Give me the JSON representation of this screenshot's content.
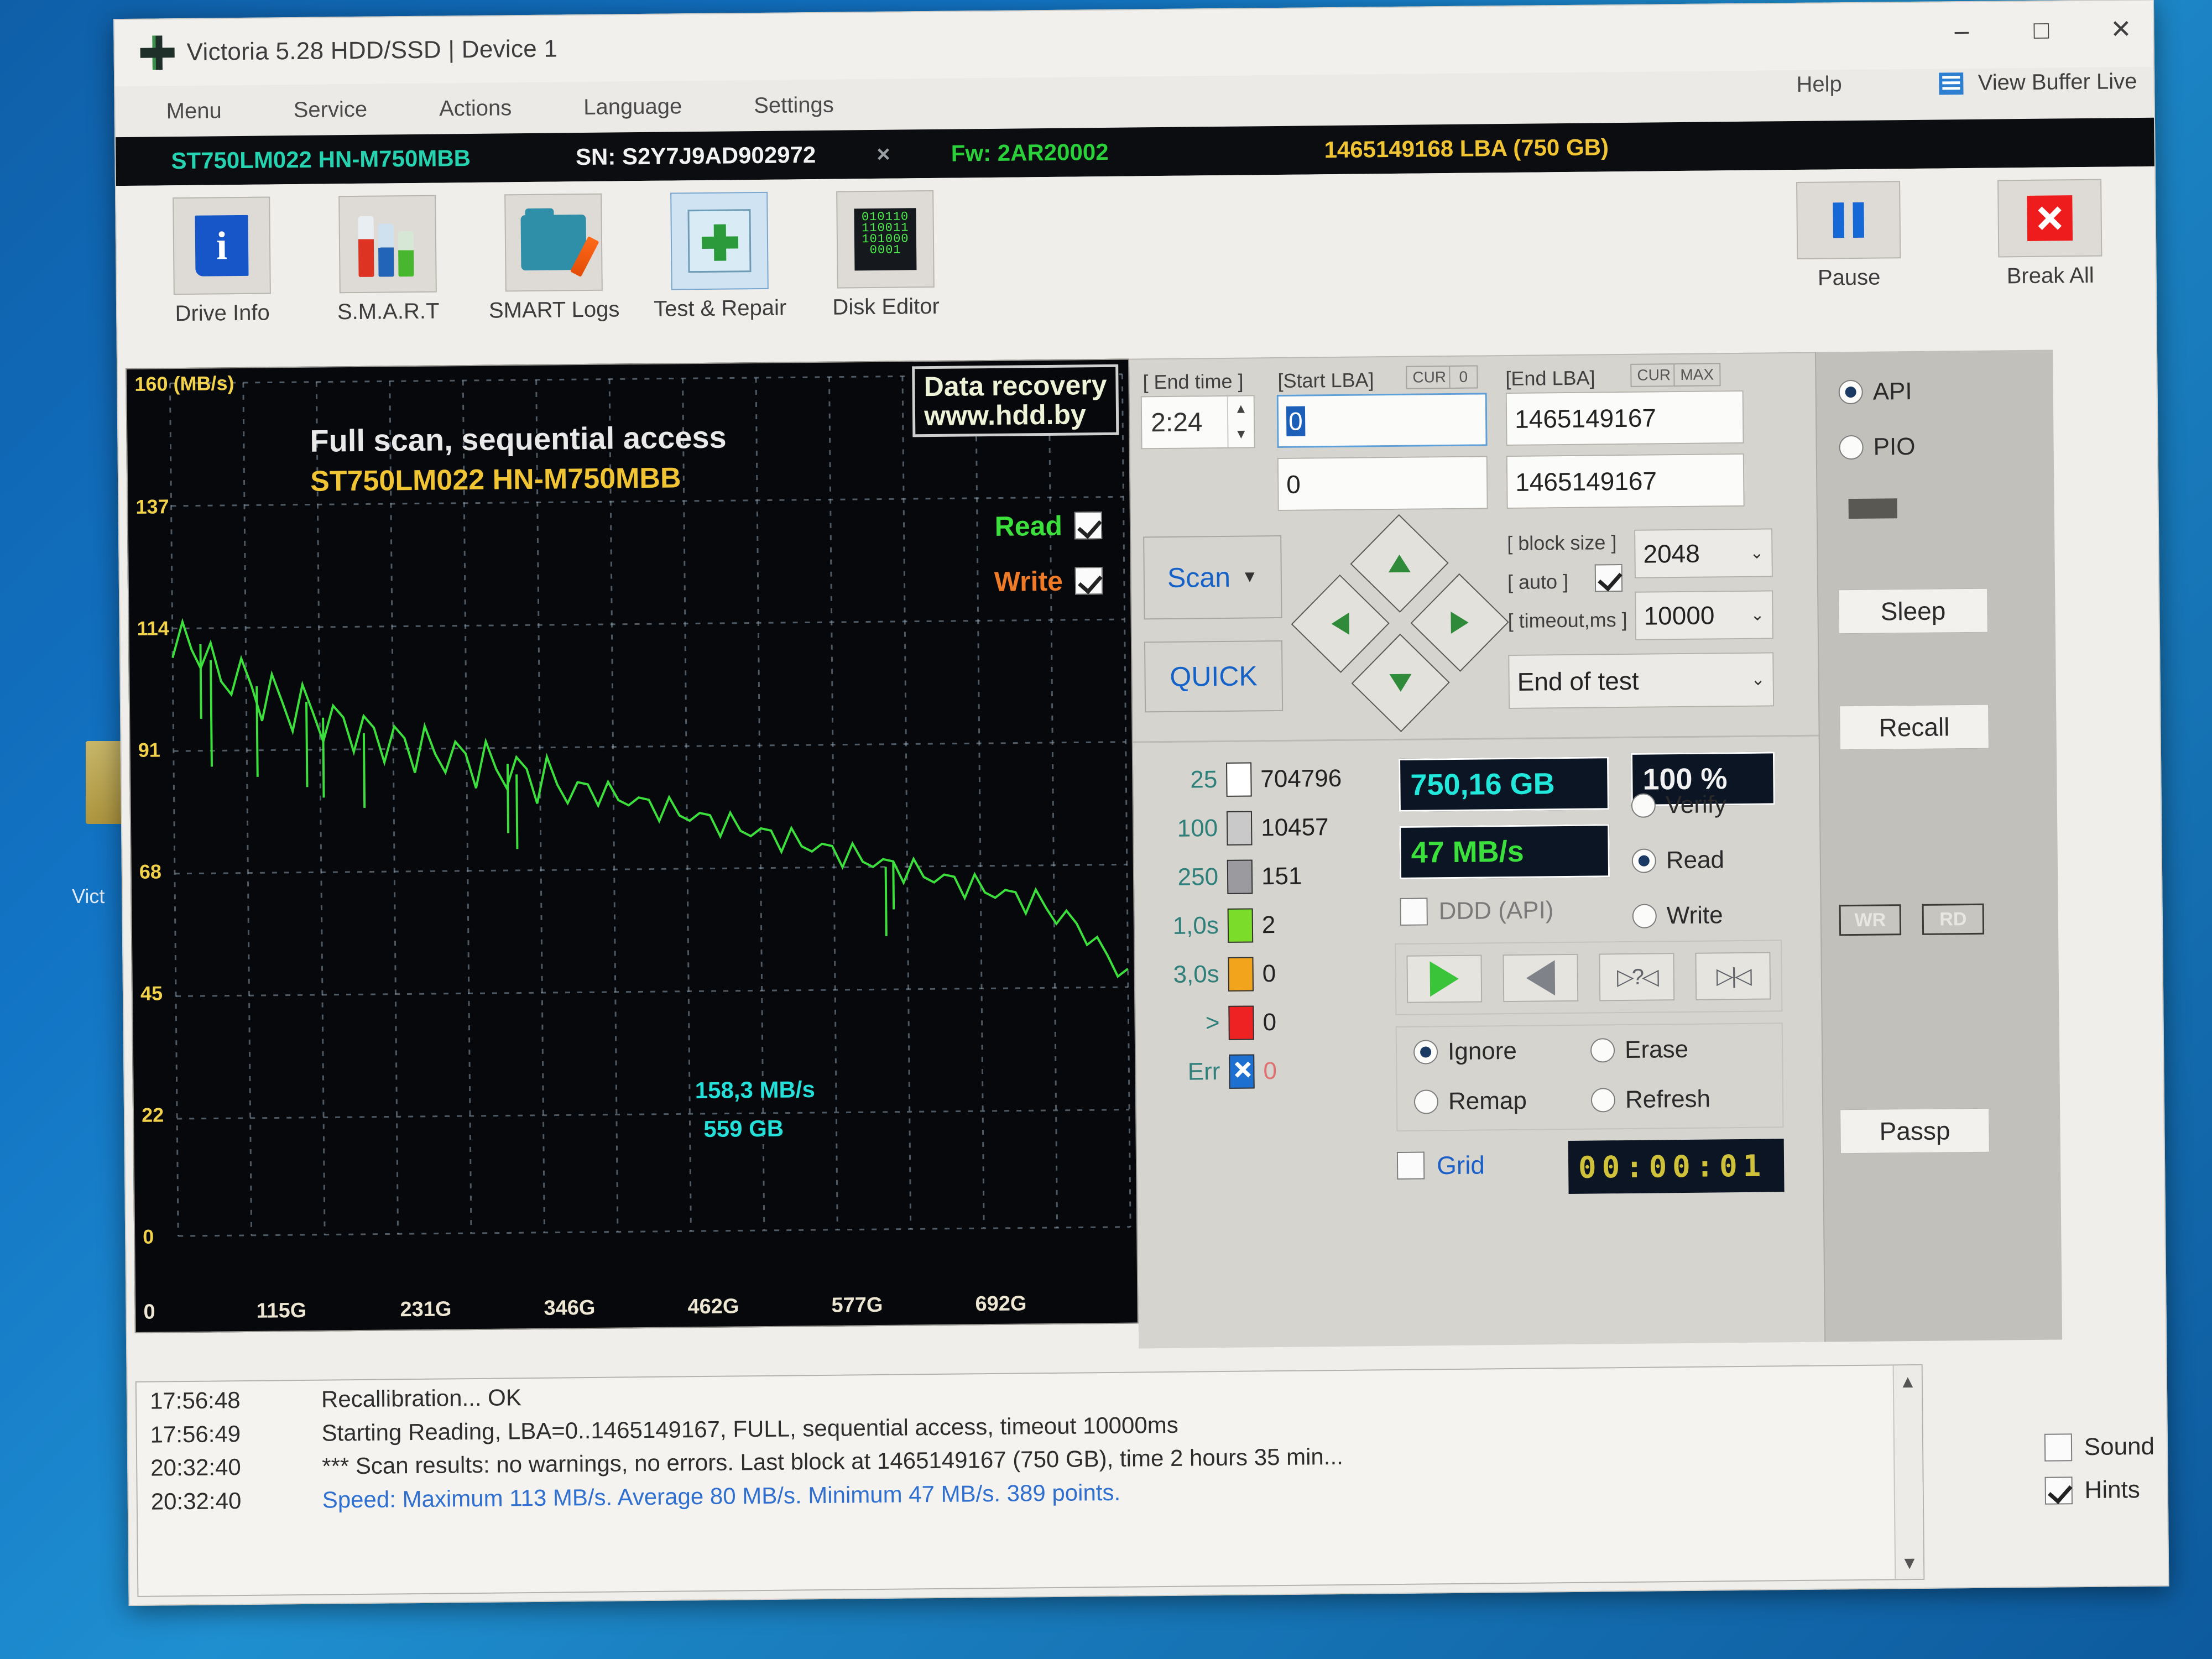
{
  "window": {
    "title": "Victoria 5.28 HDD/SSD | Device 1",
    "minimize": "–",
    "maximize": "□",
    "close": "✕"
  },
  "menu": {
    "items": [
      "Menu",
      "Service",
      "Actions",
      "Language",
      "Settings"
    ],
    "help": "Help",
    "view_buffer": "View Buffer Live"
  },
  "drive_bar": {
    "model": "ST750LM022 HN-M750MBB",
    "serial": "SN: S2Y7J9AD902972",
    "x": "×",
    "firmware": "Fw: 2AR20002",
    "capacity": "1465149168 LBA  (750 GB)"
  },
  "toolbar": {
    "items": [
      {
        "label": "Drive Info",
        "icon": "info-icon"
      },
      {
        "label": "S.M.A.R.T",
        "icon": "test-tubes-icon"
      },
      {
        "label": "SMART Logs",
        "icon": "folder-pencil-icon"
      },
      {
        "label": "Test & Repair",
        "icon": "clipboard-plus-icon"
      },
      {
        "label": "Disk Editor",
        "icon": "binary-icon"
      }
    ],
    "pause": "Pause",
    "break_all": "Break All"
  },
  "graph": {
    "title": "Full scan, sequential access",
    "subtitle": "ST750LM022 HN-M750MBB",
    "badge_line1": "Data recovery",
    "badge_line2": "www.hdd.by",
    "read_label": "Read",
    "read_checked": true,
    "write_label": "Write",
    "write_checked": true,
    "annot_speed": "158,3 MB/s",
    "annot_size": "559 GB"
  },
  "chart_data": {
    "type": "line",
    "title": "Full scan, sequential access",
    "subtitle": "ST750LM022 HN-M750MBB",
    "xlabel": "",
    "ylabel": "MB/s",
    "yunit": "160 (MB/s)",
    "ylim": [
      0,
      160
    ],
    "yticks": [
      0,
      22,
      45,
      68,
      91,
      114,
      137,
      160
    ],
    "ytick_labels": [
      "0",
      "22",
      "45",
      "68",
      "91",
      "114",
      "137",
      "160 (MB/s)"
    ],
    "xlim": [
      0,
      750
    ],
    "xticks": [
      0,
      115,
      231,
      346,
      462,
      577,
      692
    ],
    "xtick_labels": [
      "0",
      "115G",
      "231G",
      "346G",
      "462G",
      "577G",
      "692G"
    ],
    "grid": true,
    "legend": [
      "Read",
      "Write"
    ],
    "series": [
      {
        "name": "Read",
        "color": "#3ce03c",
        "x": [
          0,
          8,
          15,
          22,
          30,
          38,
          46,
          54,
          62,
          70,
          78,
          86,
          94,
          102,
          110,
          118,
          126,
          134,
          142,
          150,
          158,
          166,
          174,
          182,
          190,
          198,
          206,
          214,
          222,
          230,
          238,
          246,
          254,
          262,
          270,
          278,
          286,
          294,
          302,
          310,
          318,
          326,
          334,
          342,
          350,
          358,
          366,
          374,
          382,
          390,
          398,
          406,
          414,
          422,
          430,
          438,
          446,
          454,
          462,
          470,
          478,
          486,
          494,
          502,
          510,
          518,
          526,
          534,
          542,
          550,
          558,
          566,
          574,
          582,
          590,
          598,
          606,
          614,
          622,
          630,
          638,
          646,
          654,
          662,
          670,
          678,
          686,
          694,
          702,
          710,
          718,
          726,
          734,
          742,
          750
        ],
        "y": [
          113,
          112,
          110,
          111,
          108,
          104,
          106,
          105,
          103,
          101,
          102,
          100,
          99,
          100,
          98,
          97,
          96,
          97,
          95,
          94,
          95,
          93,
          92,
          93,
          91,
          92,
          90,
          91,
          89,
          90,
          88,
          89,
          87,
          88,
          86,
          87,
          85,
          86,
          84,
          85,
          83,
          84,
          82,
          83,
          81,
          82,
          80,
          81,
          79,
          80,
          78,
          79,
          77,
          78,
          76,
          77,
          75,
          76,
          74,
          75,
          73,
          74,
          72,
          73,
          71,
          72,
          70,
          71,
          69,
          70,
          68,
          69,
          67,
          68,
          66,
          67,
          65,
          66,
          64,
          65,
          63,
          64,
          62,
          63,
          61,
          62,
          60,
          59,
          58,
          57,
          55,
          53,
          51,
          49,
          47
        ]
      }
    ],
    "annotations": [
      {
        "text": "158,3 MB/s",
        "color": "#24e0d8"
      },
      {
        "text": "559 GB",
        "color": "#24e0d8"
      }
    ],
    "stats": {
      "maximum": 113,
      "average": 80,
      "minimum": 47,
      "points": 389
    }
  },
  "controls": {
    "end_time_label": "[ End time ]",
    "end_time_value": "2:24",
    "start_lba_label": "[Start LBA]",
    "start_lba_cur": "CUR",
    "start_lba_zero": "0",
    "start_lba_value": "0",
    "start_lba_value2": "0",
    "end_lba_label": "[End LBA]",
    "end_lba_cur": "CUR",
    "end_lba_max": "MAX",
    "end_lba_value": "1465149167",
    "end_lba_value2": "1465149167",
    "scan_button": "Scan",
    "quick_button": "QUICK",
    "block_size_label": "[ block size ]",
    "block_size_value": "2048",
    "auto_label": "[ auto ]",
    "auto_checked": true,
    "timeout_label": "[ timeout,ms ]",
    "timeout_value": "10000",
    "end_of_test": "End of test"
  },
  "legend": [
    {
      "key": "25",
      "color": "#ffffff",
      "count": "704796"
    },
    {
      "key": "100",
      "color": "#c9c9c9",
      "count": "10457"
    },
    {
      "key": "250",
      "color": "#9a9a9f",
      "count": "151"
    },
    {
      "key": "1,0s",
      "color": "#7bdd2a",
      "count": "2"
    },
    {
      "key": "3,0s",
      "color": "#f2a41c",
      "count": "0"
    },
    {
      "key": ">",
      "color": "#ee2222",
      "count": "0"
    },
    {
      "key": "Err",
      "color": "#1d6fd0",
      "count": "0"
    }
  ],
  "stats_panel": {
    "capacity": "750,16 GB",
    "percent": "100    %",
    "speed": "47 MB/s",
    "ddd_label": "DDD (API)",
    "ddd_checked": false,
    "modes": [
      {
        "label": "Verify",
        "selected": false
      },
      {
        "label": "Read",
        "selected": true
      },
      {
        "label": "Write",
        "selected": false
      }
    ],
    "actions": [
      {
        "label": "Ignore",
        "selected": true
      },
      {
        "label": "Erase",
        "selected": false
      },
      {
        "label": "Remap",
        "selected": false
      },
      {
        "label": "Refresh",
        "selected": false
      }
    ],
    "grid_label": "Grid",
    "grid_checked": false,
    "timer": "00:00:01",
    "nav_buttons": [
      "play-icon",
      "rewind-icon",
      "seek-question-icon",
      "skip-end-icon"
    ]
  },
  "rail": {
    "api_label": "API",
    "api_selected": true,
    "pio_label": "PIO",
    "pio_selected": false,
    "sleep": "Sleep",
    "recall": "Recall",
    "wr": "WR",
    "rd": "RD",
    "passp": "Passp"
  },
  "log": {
    "lines": [
      {
        "time": "17:56:48",
        "msg": "Recallibration... OK",
        "blue": false
      },
      {
        "time": "17:56:49",
        "msg": "Starting Reading, LBA=0..1465149167, FULL, sequential access, timeout 10000ms",
        "blue": false
      },
      {
        "time": "20:32:40",
        "msg": "*** Scan results: no warnings, no errors. Last block at 1465149167 (750 GB), time 2 hours 35 min...",
        "blue": false
      },
      {
        "time": "20:32:40",
        "msg": "Speed: Maximum 113 MB/s. Average 80 MB/s. Minimum 47 MB/s. 389 points.",
        "blue": true
      }
    ]
  },
  "footer": {
    "sound_label": "Sound",
    "sound_checked": false,
    "hints_label": "Hints",
    "hints_checked": true
  },
  "desktop": {
    "label": "Vict"
  }
}
